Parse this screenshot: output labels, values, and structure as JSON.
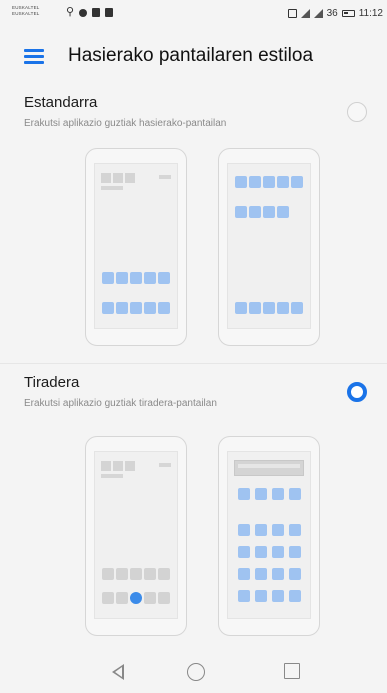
{
  "status_bar": {
    "carrier_1": "EUSKALTEL",
    "carrier_2": "EUSKALTEL",
    "battery_level": "36",
    "time": "11:12"
  },
  "app_bar": {
    "title": "Hasierako pantailaren estiloa",
    "menu_icon": "hamburger-menu-icon"
  },
  "options": [
    {
      "title": "Estandarra",
      "description": "Erakutsi aplikazio guztiak hasierako-pantailan",
      "selected": false
    },
    {
      "title": "Tiradera",
      "description": "Erakutsi aplikazio guztiak tiradera-pantailan",
      "selected": true
    }
  ],
  "colors": {
    "accent": "#1a73e8",
    "icon_tile": "#9fc3f1",
    "background": "#f4f4f4"
  },
  "nav_bar": {
    "back_icon": "back-triangle-icon",
    "home_icon": "home-circle-icon",
    "recent_icon": "recent-apps-square-icon"
  }
}
